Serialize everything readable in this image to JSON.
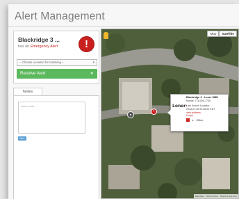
{
  "page": {
    "title": "Alert Management"
  },
  "alert": {
    "name": "Blackridge 3 ...",
    "subtitle_prefix": "has an ",
    "subtitle_emphasis": "Emergency Alert",
    "icon": "exclamation-icon",
    "reason_placeholder": "-- Choose a reason for resolving --",
    "resolve_label": "Resolve Alert",
    "resolve_chevron": "»"
  },
  "notes": {
    "tab_label": "Notes",
    "placeholder": "Add a note...",
    "save_label": "Save"
  },
  "map": {
    "type_buttons": [
      "Map",
      "Satellite"
    ],
    "active_type": "Satellite",
    "info": {
      "title": "Blackridge 3 - Loner SMD",
      "mobile": "Mobile: 778-000-7735",
      "logo_text": "Loner",
      "last_known": "Last Known Location",
      "timestamp": "2018-07-05 22:58:22 EDT",
      "address_link": "view address",
      "accuracy": "6 mph",
      "status_label": "Offline"
    },
    "footer": [
      "Map Data",
      "Terms of Use",
      "Report a map error"
    ]
  },
  "colors": {
    "alert_red": "#c8201f",
    "resolve_green": "#5cb85c",
    "title_gray": "#7c7c7c"
  }
}
